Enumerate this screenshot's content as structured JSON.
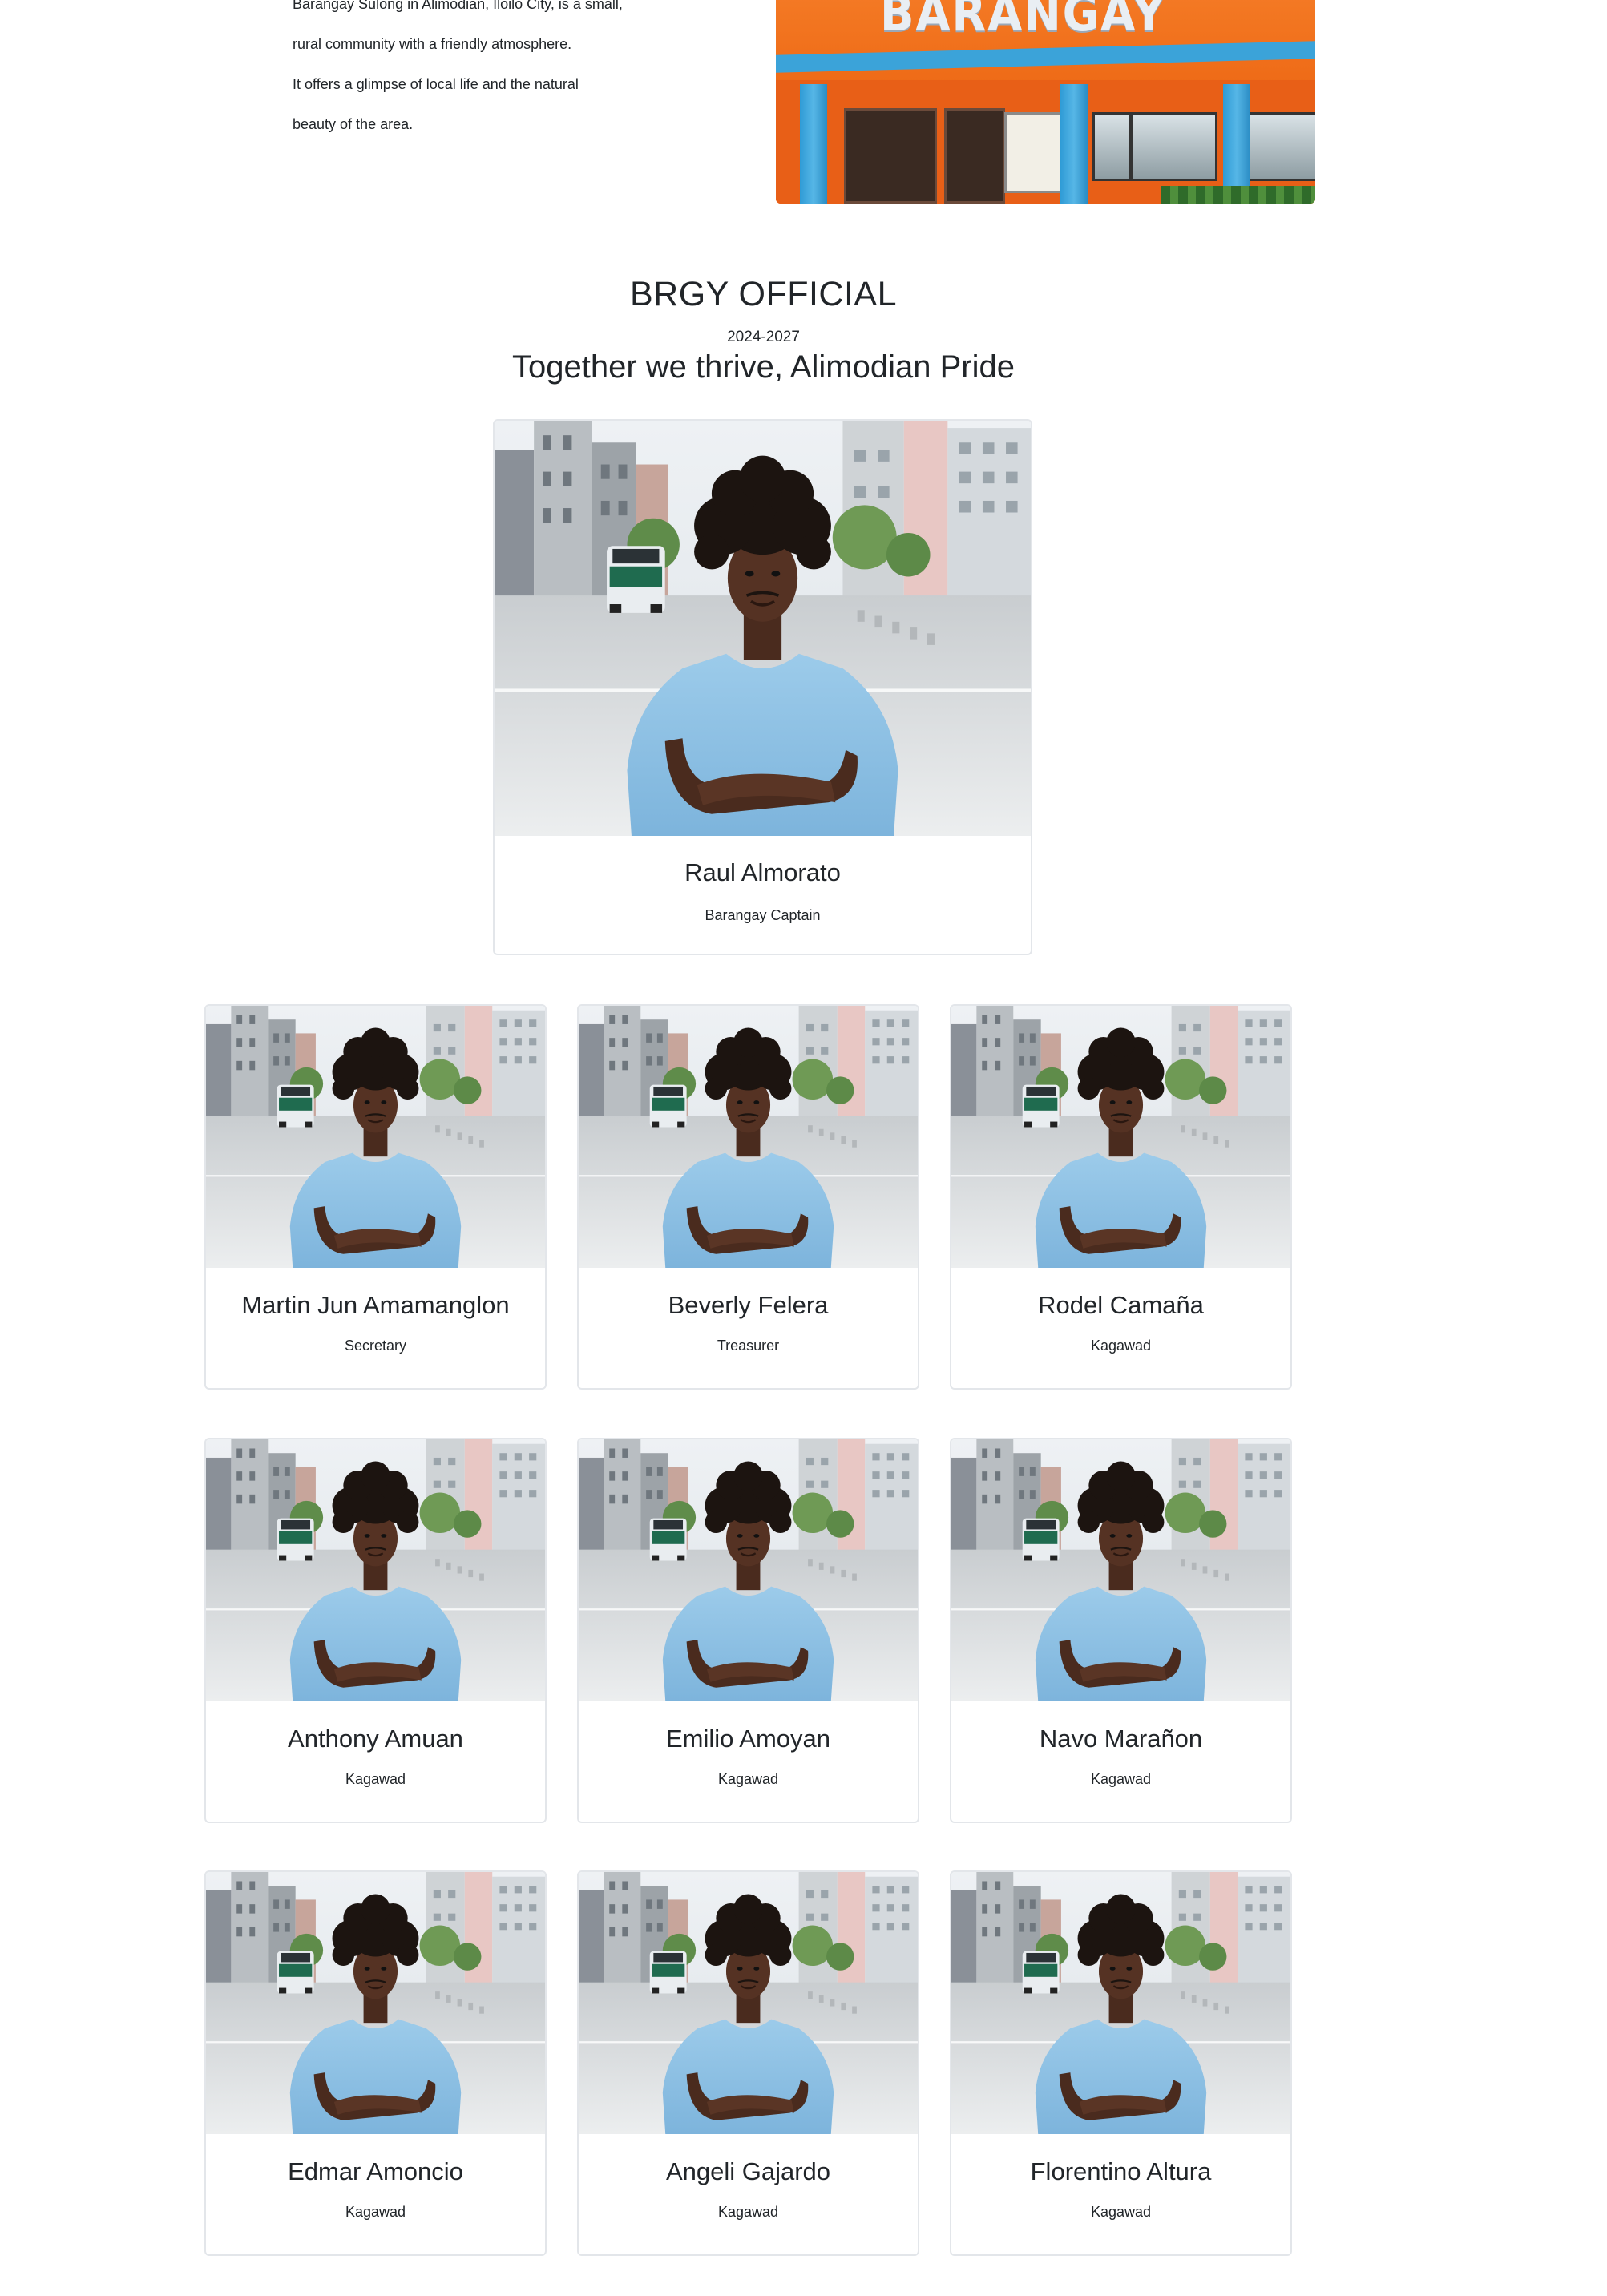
{
  "intro": {
    "lines": [
      "Barangay Sulong in Alimodian, Iloilo City, is a small,",
      "rural community with a friendly atmosphere.",
      "It offers a glimpse of local life and the natural",
      "beauty of the area."
    ],
    "photo_sign": "BARANGAY"
  },
  "officials_section": {
    "title": "BRGY OFFICIAL",
    "term": "2024-2027",
    "tagline": "Together we thrive, Alimodian Pride"
  },
  "captain": {
    "name": "Raul Almorato",
    "role": "Barangay Captain"
  },
  "officials": [
    {
      "name": "Martin Jun Amamanglon",
      "role": "Secretary"
    },
    {
      "name": "Beverly Felera",
      "role": "Treasurer"
    },
    {
      "name": "Rodel Camaña",
      "role": "Kagawad"
    },
    {
      "name": "Anthony Amuan",
      "role": "Kagawad"
    },
    {
      "name": "Emilio Amoyan",
      "role": "Kagawad"
    },
    {
      "name": "Navo Marañon",
      "role": "Kagawad"
    },
    {
      "name": "Edmar Amoncio",
      "role": "Kagawad"
    },
    {
      "name": "Angeli Gajardo",
      "role": "Kagawad"
    },
    {
      "name": "Florentino Altura",
      "role": "Kagawad"
    }
  ]
}
